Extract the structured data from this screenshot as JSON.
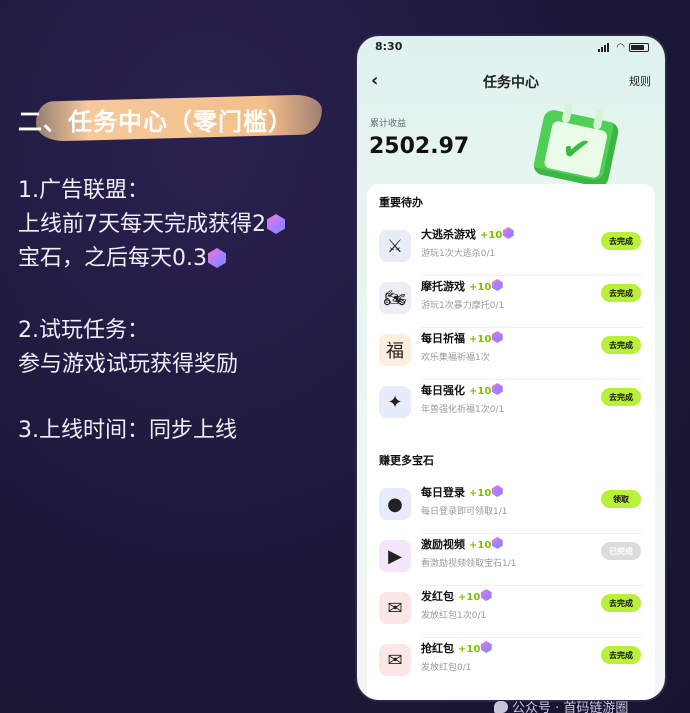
{
  "promo": {
    "heading": "二、任务中心（零门槛）",
    "sections": [
      {
        "title": "1.广告联盟：",
        "line1": "上线前7天每天完成获得2",
        "line2": "宝石，之后每天0.3"
      },
      {
        "title": "2.试玩任务：",
        "line1": "参与游戏试玩获得奖励"
      },
      {
        "title": "3.上线时间：同步上线"
      }
    ]
  },
  "phone": {
    "status_time": "8:30",
    "nav": {
      "title": "任务中心",
      "rules": "规则"
    },
    "earnings": {
      "label": "累计收益",
      "value": "2502.97"
    },
    "groups": [
      {
        "title": "重要待办",
        "tasks": [
          {
            "name": "大逃杀游戏",
            "reward": "+10",
            "desc": "游玩1次大逃杀0/1",
            "button": "去完成",
            "icon": "swords-icon",
            "glyph": "⚔",
            "bg": "#e8ecf6"
          },
          {
            "name": "摩托游戏",
            "reward": "+10",
            "desc": "游玩1次暴力摩托0/1",
            "button": "去完成",
            "icon": "motorcycle-icon",
            "glyph": "🏍",
            "bg": "#eceef6"
          },
          {
            "name": "每日祈福",
            "reward": "+10",
            "desc": "欢乐集福祈福1次",
            "button": "去完成",
            "icon": "blessing-icon",
            "glyph": "福",
            "bg": "#fdeedd"
          },
          {
            "name": "每日强化",
            "reward": "+10",
            "desc": "年兽强化祈福1次0/1",
            "button": "去完成",
            "icon": "upgrade-icon",
            "glyph": "✦",
            "bg": "#e6ecfa"
          }
        ]
      },
      {
        "title": "赚更多宝石",
        "tasks": [
          {
            "name": "每日登录",
            "reward": "+10",
            "desc": "每日登录即可领取1/1",
            "button": "领取",
            "icon": "user-icon",
            "glyph": "●",
            "bg": "#e8ebfb"
          },
          {
            "name": "激励视频",
            "reward": "+10",
            "desc": "看激励视频领取宝石1/1",
            "button": "已完成",
            "icon": "video-icon",
            "glyph": "▶",
            "bg": "#f4e6fb",
            "done": true
          },
          {
            "name": "发红包",
            "reward": "+10",
            "desc": "发放红包1次0/1",
            "button": "去完成",
            "icon": "red-envelope-icon",
            "glyph": "✉",
            "bg": "#fde6e6"
          },
          {
            "name": "抢红包",
            "reward": "+10",
            "desc": "发放红包0/1",
            "button": "去完成",
            "icon": "grab-envelope-icon",
            "glyph": "✉",
            "bg": "#fde6e6"
          }
        ]
      }
    ]
  },
  "watermark": "公众号 · 首码链游圈",
  "colors": {
    "accent": "#b8f03a",
    "reward": "#7cc000",
    "brush": "#f3c08c"
  }
}
